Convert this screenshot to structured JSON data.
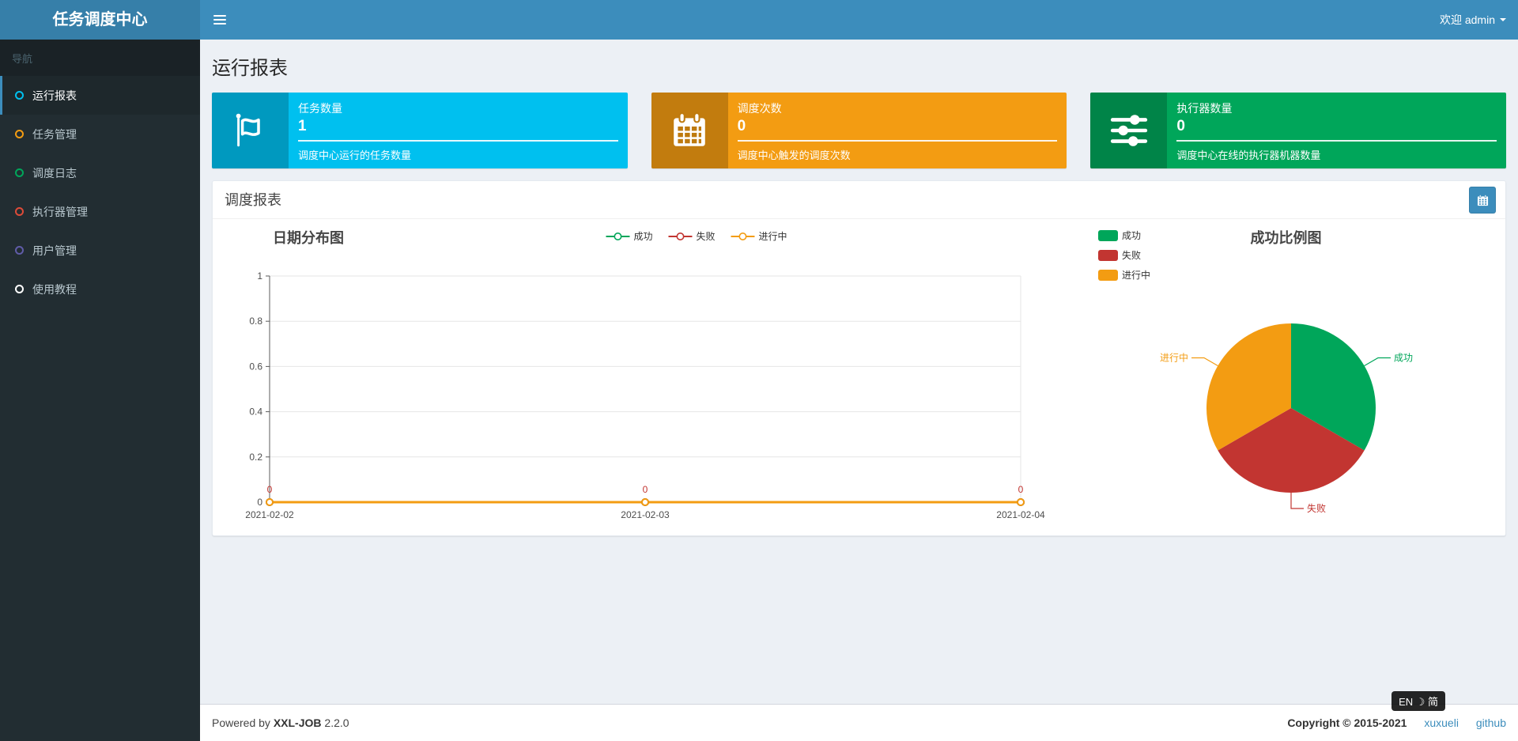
{
  "app": {
    "title": "任务调度中心"
  },
  "header": {
    "welcome": "欢迎 admin"
  },
  "sidebar": {
    "nav_label": "导航",
    "items": [
      {
        "key": "run-report",
        "label": "运行报表",
        "color": "#00c0ef",
        "active": true
      },
      {
        "key": "job-manage",
        "label": "任务管理",
        "color": "#f39c12",
        "active": false
      },
      {
        "key": "job-log",
        "label": "调度日志",
        "color": "#00a65a",
        "active": false
      },
      {
        "key": "executor-manage",
        "label": "执行器管理",
        "color": "#dd4b39",
        "active": false
      },
      {
        "key": "user-manage",
        "label": "用户管理",
        "color": "#605ca8",
        "active": false
      },
      {
        "key": "help",
        "label": "使用教程",
        "color": "#ffffff",
        "active": false
      }
    ]
  },
  "page": {
    "title": "运行报表"
  },
  "info_boxes": [
    {
      "key": "job-count",
      "icon": "flag-icon",
      "color": "#00c0ef",
      "label": "任务数量",
      "value": "1",
      "desc": "调度中心运行的任务数量"
    },
    {
      "key": "trigger-count",
      "icon": "calendar-icon",
      "color": "#f39c12",
      "label": "调度次数",
      "value": "0",
      "desc": "调度中心触发的调度次数"
    },
    {
      "key": "executor-count",
      "icon": "sliders-icon",
      "color": "#00a65a",
      "label": "执行器数量",
      "value": "0",
      "desc": "调度中心在线的执行器机器数量"
    }
  ],
  "panel": {
    "title": "调度报表"
  },
  "chart_data": [
    {
      "type": "line",
      "title": "日期分布图",
      "categories": [
        "2021-02-02",
        "2021-02-03",
        "2021-02-04"
      ],
      "series": [
        {
          "key": "success",
          "name": "成功",
          "color": "#00a65a",
          "values": [
            0,
            0,
            0
          ]
        },
        {
          "key": "fail",
          "name": "失败",
          "color": "#c23531",
          "values": [
            0,
            0,
            0
          ]
        },
        {
          "key": "running",
          "name": "进行中",
          "color": "#f39c12",
          "values": [
            0,
            0,
            0
          ]
        }
      ],
      "ylim": [
        0,
        1
      ],
      "yticks": [
        0,
        0.2,
        0.4,
        0.6,
        0.8,
        1
      ],
      "point_labels": [
        "0",
        "0",
        "0"
      ],
      "point_label_color": "#c23531",
      "grid": true,
      "legend_position": "top"
    },
    {
      "type": "pie",
      "title": "成功比例图",
      "series": [
        {
          "key": "success",
          "name": "成功",
          "value": 1,
          "color": "#00a65a"
        },
        {
          "key": "fail",
          "name": "失败",
          "value": 1,
          "color": "#c23531"
        },
        {
          "key": "running",
          "name": "进行中",
          "value": 1,
          "color": "#f39c12"
        }
      ],
      "legend_position": "left"
    }
  ],
  "footer": {
    "powered_prefix": "Powered by",
    "brand": "XXL-JOB",
    "version": "2.2.0",
    "copyright": "Copyright © 2015-2021",
    "links": [
      {
        "key": "xuxueli",
        "label": "xuxueli"
      },
      {
        "key": "github",
        "label": "github"
      }
    ]
  },
  "ime_badge": "EN ☽ 简"
}
